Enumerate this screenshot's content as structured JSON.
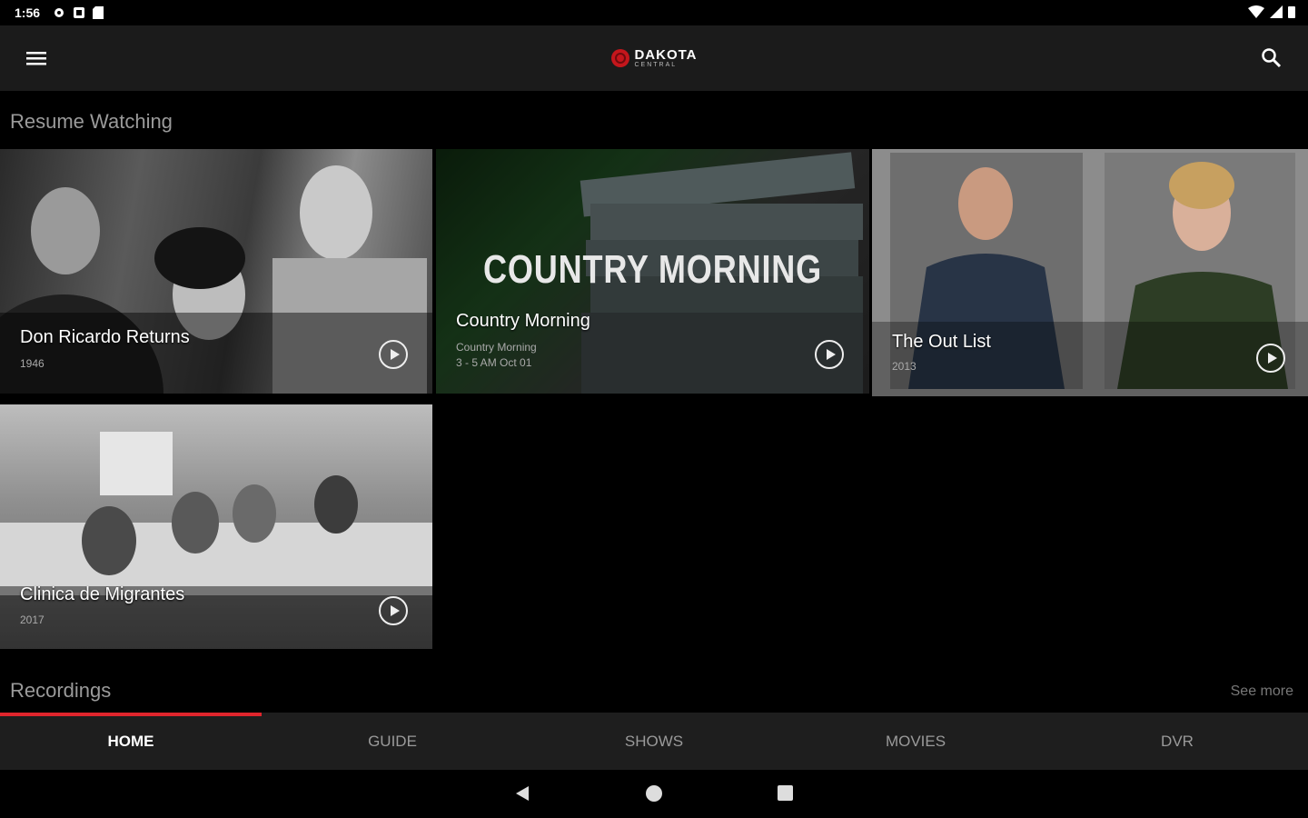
{
  "status": {
    "time": "1:56"
  },
  "app": {
    "logo_main": "DAKOTA",
    "logo_sub": "CENTRAL"
  },
  "resume": {
    "title": "Resume Watching",
    "items": [
      {
        "title": "Don Ricardo Returns",
        "sub1": "1946",
        "sub2": ""
      },
      {
        "title": "Country Morning",
        "overlay": "COUNTRY MORNING",
        "sub1": "Country Morning",
        "sub2": "3 - 5 AM Oct 01"
      },
      {
        "title": "The Out List",
        "sub1": "2013",
        "sub2": ""
      },
      {
        "title": "Clinica de Migrantes",
        "sub1": "2017",
        "sub2": ""
      }
    ]
  },
  "recordings": {
    "title": "Recordings",
    "see_more": "See more"
  },
  "tabs": [
    "HOME",
    "GUIDE",
    "SHOWS",
    "MOVIES",
    "DVR"
  ],
  "colors": {
    "accent": "#e0252c",
    "appbar": "#1b1b1b",
    "tabbar": "#1e1e1e"
  },
  "icons": [
    "menu-icon",
    "search-icon",
    "play-icon",
    "back-icon",
    "home-icon",
    "recents-icon"
  ]
}
